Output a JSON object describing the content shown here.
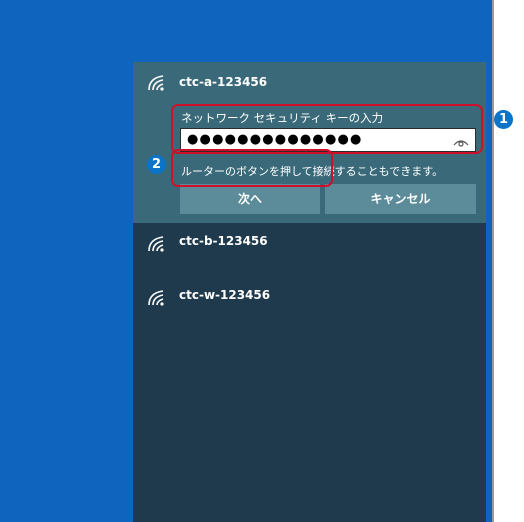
{
  "networks": [
    {
      "ssid": "ctc-a-123456"
    },
    {
      "ssid": "ctc-b-123456"
    },
    {
      "ssid": "ctc-w-123456"
    }
  ],
  "connect_form": {
    "key_label": "ネットワーク セキュリティ キーの入力",
    "password_value": "●●●●●●●●●●●●●●",
    "hint": "ルーターのボタンを押して接続することもできます。",
    "next_label": "次へ",
    "cancel_label": "キャンセル"
  },
  "annotations": {
    "badge_1": "1",
    "badge_2": "2"
  },
  "icons": {
    "wifi": "wifi-signal-icon",
    "reveal": "eye-icon"
  },
  "colors": {
    "desktop_blue": "#0f64be",
    "panel_dark": "#1e3a4c",
    "expanded_teal": "#3a6a7a",
    "button": "#5c8c9a",
    "callout_red": "#d0102a",
    "badge_blue": "#0a74c8"
  }
}
